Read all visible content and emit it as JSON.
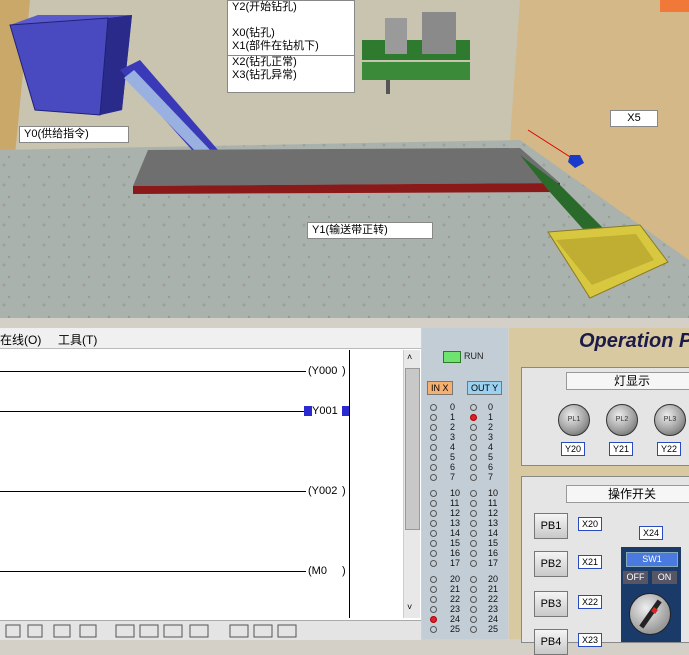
{
  "scene": {
    "labels": {
      "y2": "Y2(开始钻孔)",
      "x0": "X0(钻孔)",
      "x1": "X1(部件在钻机下)",
      "x2": "X2(钻孔正常)",
      "x3": "X3(钻孔异常)",
      "y0": "Y0(供给指令)",
      "x5": "X5",
      "y1": "Y1(输送带正转)"
    }
  },
  "ladder": {
    "menu": {
      "online": "在线(O)",
      "tools": "工具(T)"
    },
    "coils": [
      "(Y000",
      "Y001",
      "(Y002",
      "(M0"
    ]
  },
  "io": {
    "run_label": "RUN",
    "in_header": "IN X",
    "out_header": "OUT Y",
    "groups": [
      [
        "0",
        "1",
        "2",
        "3",
        "4",
        "5",
        "6",
        "7"
      ],
      [
        "10",
        "11",
        "12",
        "13",
        "14",
        "15",
        "16",
        "17"
      ],
      [
        "20",
        "21",
        "22",
        "23",
        "24",
        "25"
      ]
    ],
    "in_on": [
      "24"
    ],
    "out_on": [
      "1"
    ]
  },
  "op": {
    "title": "Operation Pa",
    "lamps_title": "灯显示",
    "lamps": [
      {
        "label": "PL1",
        "tag": "Y20"
      },
      {
        "label": "PL2",
        "tag": "Y21"
      },
      {
        "label": "PL3",
        "tag": "Y22"
      }
    ],
    "switch_title": "操作开关",
    "buttons": [
      {
        "label": "PB1",
        "tag": "X20"
      },
      {
        "label": "PB2",
        "tag": "X21"
      },
      {
        "label": "PB3",
        "tag": "X22"
      },
      {
        "label": "PB4",
        "tag": "X23"
      }
    ],
    "sw_tag": "X24",
    "sw_label": "SW1",
    "off": "OFF",
    "on": "ON"
  },
  "colors": {
    "led_on": "#e0202a",
    "run": "#6fe36f",
    "tag_border": "#2a4ac0"
  }
}
